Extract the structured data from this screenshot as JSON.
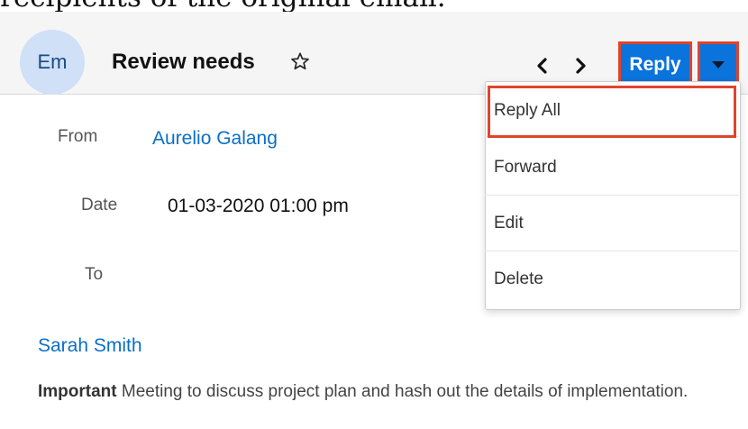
{
  "caption_fragment": "recipients of the original email.",
  "record": {
    "avatar_initials": "Em",
    "title": "Review needs"
  },
  "actions": {
    "reply_label": "Reply"
  },
  "dropdown": {
    "items": [
      "Reply All",
      "Forward",
      "Edit",
      "Delete"
    ]
  },
  "fields": {
    "from_label": "From",
    "from_value": "Aurelio Galang",
    "date_label": "Date",
    "date_value": "01-03-2020 01:00 pm",
    "to_label": "To",
    "to_value": "Sarah Smith"
  },
  "description": {
    "bold": "Important",
    "text": " Meeting to discuss project plan and hash out the details of implementation."
  },
  "colors": {
    "accent": "#0b73dc",
    "highlight": "#e0442b",
    "link": "#0b6fc8",
    "avatar_bg": "#cfe0f7"
  },
  "icons": [
    "star-icon",
    "chevron-left-icon",
    "chevron-right-icon",
    "caret-down-icon"
  ]
}
